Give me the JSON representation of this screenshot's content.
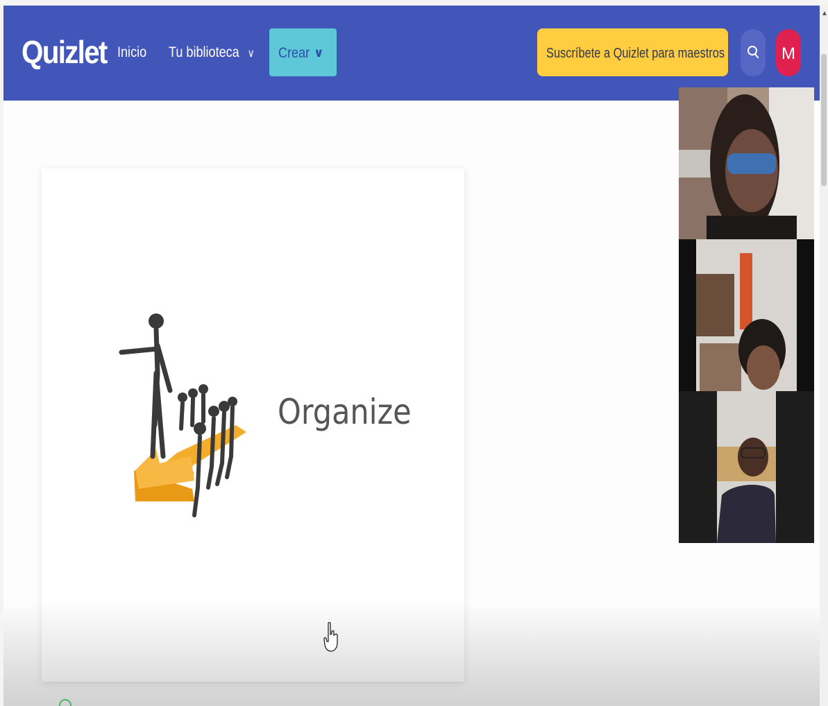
{
  "app": {
    "logo": "Quizlet"
  },
  "nav": {
    "home_label": "Inicio",
    "library_label": "Tu biblioteca",
    "create_label": "Crear",
    "subscribe_label": "Suscríbete a Quizlet para maestros",
    "avatar_initial": "M"
  },
  "card": {
    "term": "Organize"
  },
  "icons": {
    "search": "search-icon",
    "library_chevron": "chevron-down-icon",
    "create_chevron": "chevron-down-icon",
    "cursor": "hand-pointer-icon"
  },
  "colors": {
    "header_bg": "#4256b9",
    "create_button": "#5ec7d8",
    "subscribe_button": "#ffcd3f",
    "avatar": "#e0214f"
  }
}
